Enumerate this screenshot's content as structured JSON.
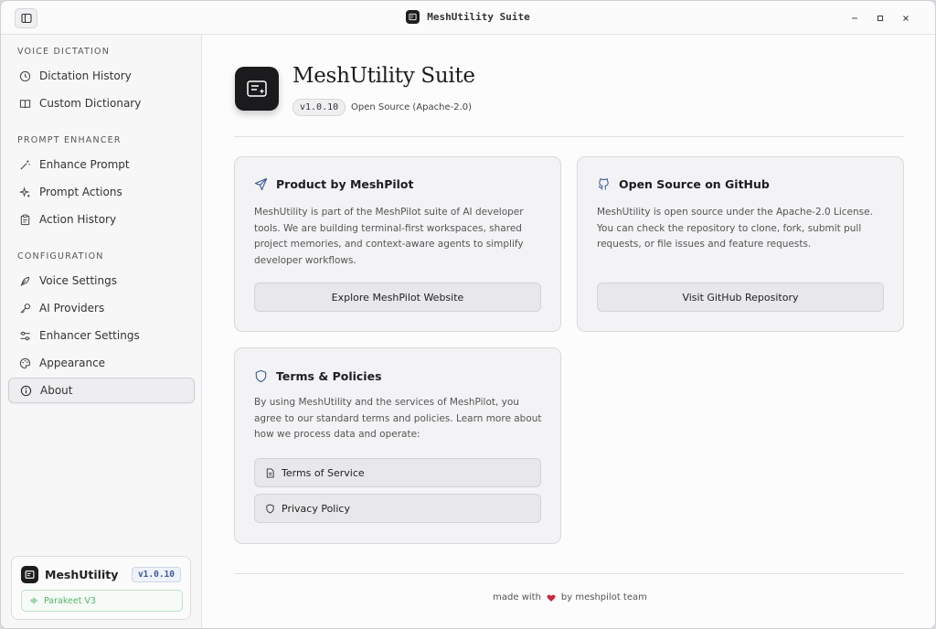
{
  "window": {
    "title": "MeshUtility Suite",
    "controls": [
      "minimize-icon",
      "maximize-icon",
      "close-icon"
    ]
  },
  "sidebar": {
    "sections": [
      {
        "title": "VOICE DICTATION",
        "items": [
          {
            "label": "Dictation History",
            "icon": "clock-icon"
          },
          {
            "label": "Custom Dictionary",
            "icon": "book-icon"
          }
        ]
      },
      {
        "title": "PROMPT ENHANCER",
        "items": [
          {
            "label": "Enhance Prompt",
            "icon": "magic-wand-icon"
          },
          {
            "label": "Prompt Actions",
            "icon": "sparkles-icon"
          },
          {
            "label": "Action History",
            "icon": "clipboard-icon"
          }
        ]
      },
      {
        "title": "CONFIGURATION",
        "items": [
          {
            "label": "Voice Settings",
            "icon": "feather-icon"
          },
          {
            "label": "AI Providers",
            "icon": "key-icon"
          },
          {
            "label": "Enhancer Settings",
            "icon": "sliders-icon"
          },
          {
            "label": "Appearance",
            "icon": "palette-icon"
          },
          {
            "label": "About",
            "icon": "info-icon",
            "active": true
          }
        ]
      }
    ],
    "footer": {
      "name": "MeshUtility",
      "version": "v1.0.10",
      "model": "Parakeet V3"
    }
  },
  "main": {
    "app_title": "MeshUtility Suite",
    "version": "v1.0.10",
    "license": "Open Source (Apache-2.0)",
    "cards": {
      "product": {
        "title": "Product by MeshPilot",
        "icon": "send-icon",
        "body": "MeshUtility is part of the MeshPilot suite of AI developer tools. We are building terminal-first workspaces, shared project memories, and context-aware agents to simplify developer workflows.",
        "button": "Explore MeshPilot Website"
      },
      "github": {
        "title": "Open Source on GitHub",
        "icon": "github-icon",
        "body": "MeshUtility is open source under the Apache-2.0 License. You can check the repository to clone, fork, submit pull requests, or file issues and feature requests.",
        "button": "Visit GitHub Repository"
      },
      "terms": {
        "title": "Terms & Policies",
        "icon": "shield-icon",
        "body": "By using MeshUtility and the services of MeshPilot, you agree to our standard terms and policies. Learn more about how we process data and operate:",
        "terms_button": "Terms of Service",
        "privacy_button": "Privacy Policy"
      }
    },
    "footer": {
      "made_with": "made with",
      "by": "by meshpilot team",
      "heart_color": "#c9283e"
    }
  },
  "colors": {
    "accent_blue": "#3e5a96",
    "model_green": "#58b36a"
  }
}
